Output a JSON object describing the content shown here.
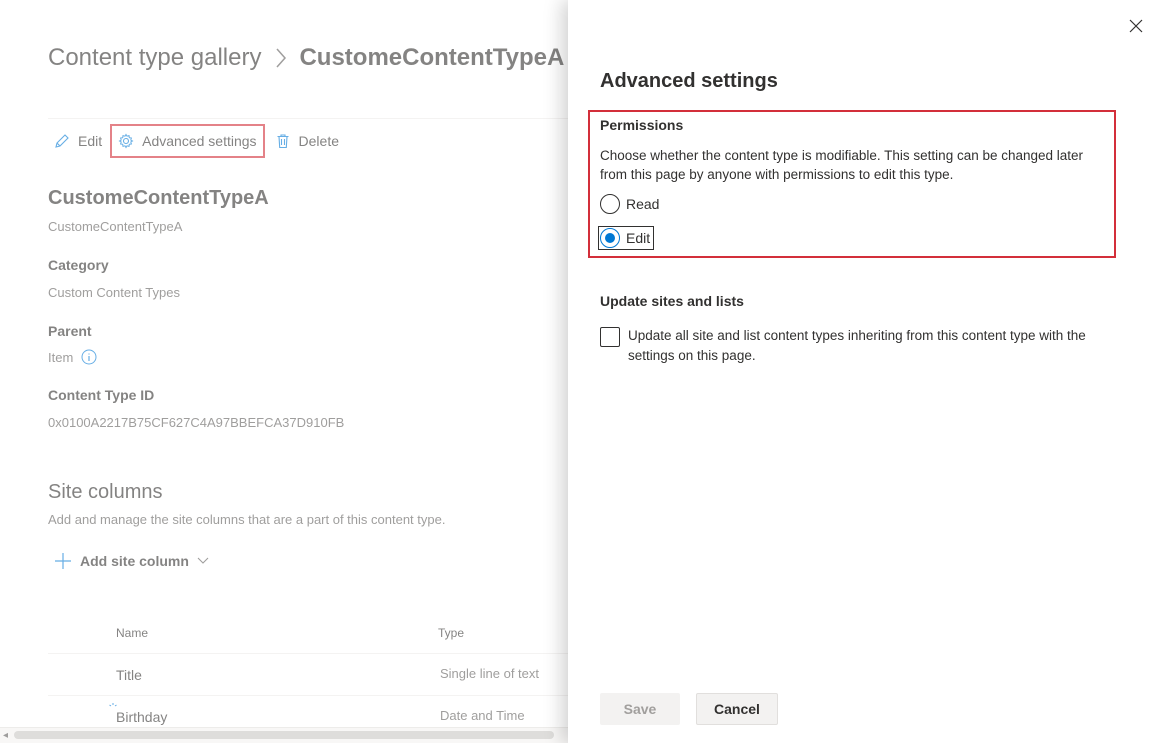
{
  "breadcrumb": {
    "root": "Content type gallery",
    "current": "CustomeContentTypeA"
  },
  "commands": {
    "edit": "Edit",
    "advanced": "Advanced settings",
    "delete": "Delete"
  },
  "content_type": {
    "title": "CustomeContentTypeA",
    "subtitle": "CustomeContentTypeA",
    "category_label": "Category",
    "category_value": "Custom Content Types",
    "parent_label": "Parent",
    "parent_value": "Item",
    "id_label": "Content Type ID",
    "id_value": "0x0100A2217B75CF627C4A97BBEFCA37D910FB"
  },
  "site_columns": {
    "title": "Site columns",
    "description": "Add and manage the site columns that are a part of this content type.",
    "add_label": "Add site column",
    "headers": {
      "name": "Name",
      "type": "Type"
    },
    "rows": [
      {
        "name": "Title",
        "type": "Single line of text"
      },
      {
        "name": "Birthday",
        "type": "Date and Time"
      }
    ]
  },
  "panel": {
    "title": "Advanced settings",
    "permissions": {
      "label": "Permissions",
      "description": "Choose whether the content type is modifiable. This setting can be changed later from this page by anyone with permissions to edit this type.",
      "options": [
        {
          "label": "Read",
          "checked": false
        },
        {
          "label": "Edit",
          "checked": true
        }
      ]
    },
    "update": {
      "label": "Update sites and lists",
      "checkbox_label": "Update all site and list content types inheriting from this content type with the settings on this page.",
      "checked": false
    },
    "buttons": {
      "save": "Save",
      "cancel": "Cancel"
    }
  },
  "colors": {
    "accent": "#0078d4",
    "highlight": "#d32f3a"
  }
}
